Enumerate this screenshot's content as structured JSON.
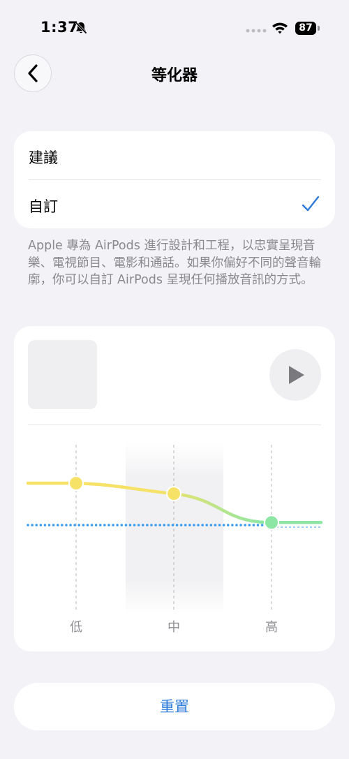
{
  "status_bar": {
    "time": "1:37",
    "battery": "87",
    "icons": [
      "bell-slash-icon",
      "signal-icon",
      "wifi-icon",
      "battery-icon"
    ]
  },
  "nav": {
    "title": "等化器",
    "back_icon": "chevron-left-icon"
  },
  "options": {
    "items": [
      {
        "label": "建議",
        "selected": false
      },
      {
        "label": "自訂",
        "selected": true
      }
    ],
    "check_icon": "checkmark-icon"
  },
  "description": "Apple 專為 AirPods 進行設計和工程，以忠實呈現音樂、電視節目、電影和通話。如果你偏好不同的聲音輪廓，你可以自訂 AirPods 呈現任何播放音訊的方式。",
  "eq": {
    "bands": [
      "低",
      "中",
      "高"
    ],
    "levels": [
      0.76,
      0.7,
      0.535
    ],
    "reference_level": 0.52,
    "play_icon": "play-icon",
    "colors": {
      "curve_start": "#f5e267",
      "curve_end": "#8ee6a5",
      "reference": "#3c9df0",
      "knob_low": "#f5e267",
      "knob_mid": "#f5e267",
      "knob_high": "#8ee6a5"
    }
  },
  "reset_label": "重置",
  "colors": {
    "accent": "#2f7bd9",
    "background": "#f2f2f7",
    "card": "#ffffff"
  }
}
